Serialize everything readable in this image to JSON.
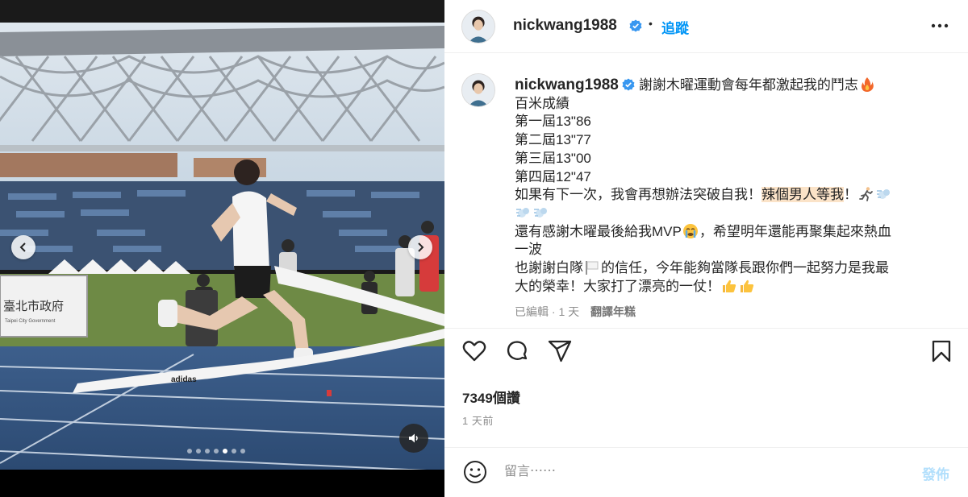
{
  "post": {
    "media": {
      "signage": "臺北市政府",
      "signage_sub": "Taipei City Government",
      "ribbon_brand": "adidas",
      "carousel_total": 7,
      "carousel_active_index": 4
    },
    "header": {
      "username": "nickwang1988",
      "separator": "•",
      "follow_label": "追蹤"
    },
    "caption": {
      "username": "nickwang1988",
      "line1": "謝謝木曜運動會每年都激起我的鬥志",
      "line2": "百米成績",
      "line3": "第一屆13\"86",
      "line4": "第二屆13\"77",
      "line5": "第三屆13\"00",
      "line6": "第四屆12\"47",
      "line7a": "如果有下一次，我會再想辦法突破自我！",
      "line7_highlight": "辣個男人等我",
      "line7b": "！",
      "line9": "還有感謝木曜最後給我MVP",
      "line9b": "，希望明年還能再聚集起來熱血",
      "line10": "一波",
      "line11a": "也謝謝白隊",
      "line11b": "的信任，今年能夠當隊長跟你們一起努力是我最",
      "line12": "大的榮幸！大家打了漂亮的一仗！"
    },
    "meta": {
      "edited": "已編輯",
      "dot": "·",
      "age": "1 天",
      "translate": "翻譯年糕"
    },
    "stats": {
      "views": "7349個讚",
      "posted": "1 天前"
    },
    "comment": {
      "placeholder": "留言⋯⋯",
      "post_label": "發佈"
    },
    "icons": {
      "verified": "verified-badge-icon",
      "fire": "fire-emoji-icon",
      "runner": "runner-emoji-icon",
      "dash": "dash-emoji-icon",
      "crying": "crying-emoji-icon",
      "white_flag": "white-flag-emoji-icon",
      "thumbs_up": "thumbs-up-emoji-icon"
    },
    "colors": {
      "accent": "#0095f6",
      "verified": "#3897f0",
      "highlight": "#fbe3c8",
      "muted": "#8e8e8e"
    }
  }
}
